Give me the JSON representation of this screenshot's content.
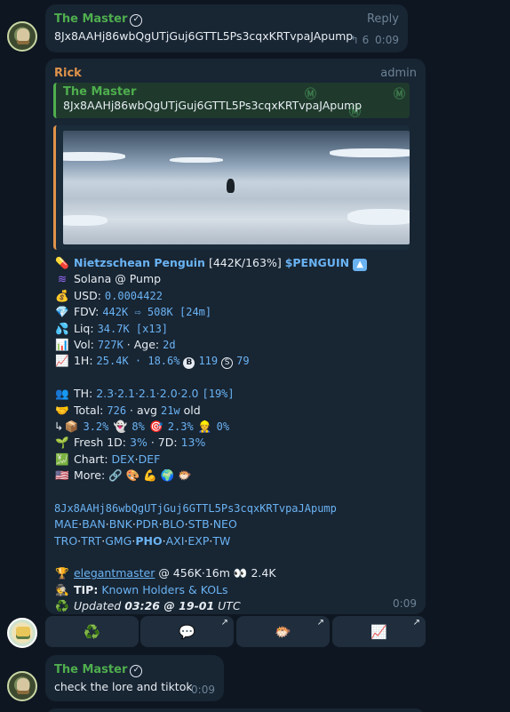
{
  "msg1": {
    "sender": "The Master",
    "text": "8Jx8AAHj86wbQgUTjGuj6GTTL5Ps3cqxKRTvpaJApump",
    "reply_label": "Reply",
    "reply_count": "6",
    "time": "0:09"
  },
  "msg2": {
    "sender": "Rick",
    "role": "admin",
    "quote": {
      "sender": "The Master",
      "text": "8Jx8AAHj86wbQgUTjGuj6GTTL5Ps3cqxKRTvpaJApump"
    },
    "time": "0:09",
    "token_name": "Nietzschean Penguin",
    "token_stats": "[442K/163%]",
    "ticker": "$PENGUIN",
    "chain": "Solana @ Pump",
    "usd_label": "USD:",
    "usd_value": "0.0004422",
    "fdv_label": "FDV:",
    "fdv_value": "442K ⇨ 508K [24m]",
    "liq_label": "Liq:",
    "liq_value": "34.7K [x13]",
    "vol_label": "Vol:",
    "vol_value": "727K",
    "age_label": "· Age:",
    "age_value": "2d",
    "h1_label": "1H:",
    "h1_value": "25.4K · 18.6%",
    "h1_buys": "119",
    "h1_sells": "79",
    "th_label": "TH:",
    "th_value": "2.3·2.1·2.1·2.0·2.0",
    "th_total": "[19%]",
    "total_label": "Total:",
    "total_value": "726",
    "total_avg": "· avg",
    "total_avg_value": "21w",
    "total_suffix": "old",
    "hold_bundle": "3.2%",
    "hold_ghost": "8%",
    "hold_sniper": "2.3%",
    "hold_dev": "0%",
    "fresh_label": "Fresh 1D:",
    "fresh_1d": "3%",
    "fresh_7d_label": "· 7D:",
    "fresh_7d": "13%",
    "chart_label": "Chart:",
    "chart_dex": "DEX",
    "chart_def": "DEF",
    "more_label": "More:",
    "address": "8Jx8AAHj86wbQgUTjGuj6GTTL5Ps3cqxKRTvpaJApump",
    "links_row1": [
      "MAE",
      "BAN",
      "BNK",
      "PDR",
      "BLO",
      "STB",
      "NEO"
    ],
    "links_row2": [
      "TRO",
      "TRT",
      "GMG",
      "PHO",
      "AXI",
      "EXP",
      "TW"
    ],
    "caller": "elegantmaster",
    "caller_stats": "@ 456K·16m",
    "caller_views": "2.4K",
    "tip_label": "TIP:",
    "tip_link": "Known Holders & KOLs",
    "updated_prefix": "Updated",
    "updated_time": "03:26 @ 19-01",
    "updated_tz": "UTC"
  },
  "keyboard": {
    "buttons": [
      "recycle-icon",
      "speech-bubble-icon",
      "pufferfish-icon",
      "chart-increasing-icon"
    ]
  },
  "msg3": {
    "sender": "The Master",
    "text": "check the lore and tiktok",
    "time": "0:09"
  },
  "colors": {
    "bg": "#0e1621",
    "bubble": "#182533",
    "link": "#6ab3f3",
    "green_name": "#4fae4e",
    "orange_name": "#e0934a"
  }
}
